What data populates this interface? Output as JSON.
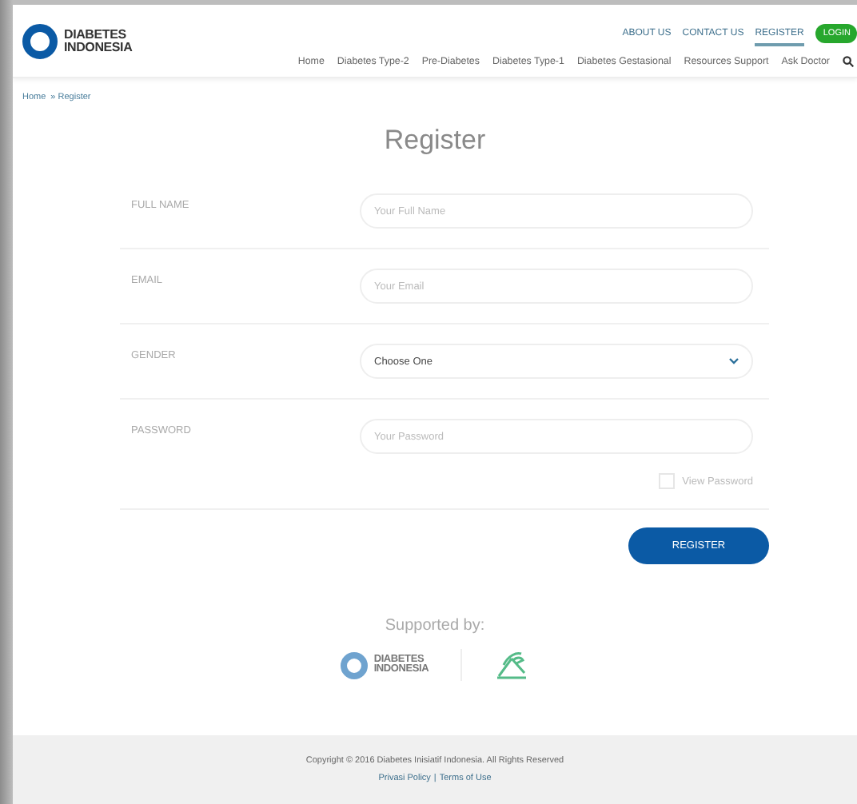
{
  "logo": {
    "lines": [
      "DIABETES",
      "INDONESIA"
    ]
  },
  "top_links": [
    {
      "label": "ABOUT US",
      "selected": false
    },
    {
      "label": "CONTACT US",
      "selected": false
    },
    {
      "label": "REGISTER",
      "selected": true
    }
  ],
  "login_button": "LOGIN",
  "nav": [
    "Home",
    "Diabetes Type-2",
    "Pre-Diabetes",
    "Diabetes Type-1",
    "Diabetes Gestasional",
    "Resources Support",
    "Ask Doctor"
  ],
  "breadcrumb": [
    "Home",
    "» Register"
  ],
  "title": "Register",
  "form": [
    {
      "kind": "text",
      "label": "FULL NAME",
      "placeholder": "Your Full Name"
    },
    {
      "kind": "text",
      "label": "EMAIL",
      "placeholder": "Your Email"
    },
    {
      "kind": "select",
      "label": "GENDER",
      "value": "Choose One"
    },
    {
      "kind": "password",
      "label": "PASSWORD",
      "placeholder": "Your Password",
      "toggle": {
        "label": "View Password",
        "checked": false
      }
    }
  ],
  "submit": "REGISTER",
  "supported": {
    "title": "Supported by:",
    "logo_lines": [
      "DIABETES",
      "INDONESIA"
    ]
  },
  "footer": {
    "copyright": "Copyright © 2016 Diabetes Inisiatif Indonesia. All Rights Reserved",
    "links": [
      "Privasi Policy",
      "Terms of Use"
    ],
    "separator": "|"
  }
}
